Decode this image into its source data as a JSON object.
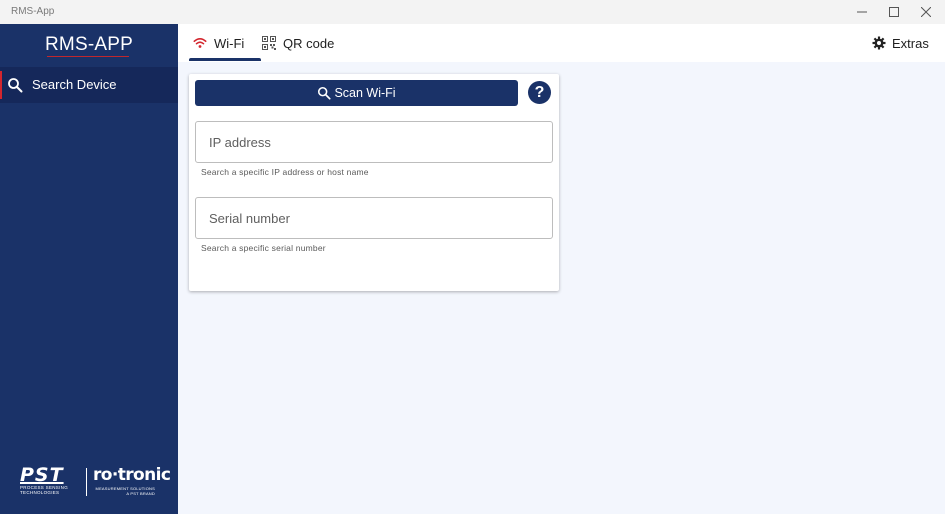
{
  "window": {
    "title": "RMS-App",
    "controls": [
      "minimize-icon",
      "maximize-icon",
      "close-icon"
    ]
  },
  "sidebar": {
    "brand": "RMS-APP",
    "items": [
      {
        "label": "Search Device",
        "icon": "search-icon",
        "active": true
      }
    ],
    "logos": {
      "pst": {
        "name": "PST",
        "line1": "PROCESS SENSING",
        "line2": "TECHNOLOGIES"
      },
      "rotronic": {
        "name": "ro·tronic",
        "line1": "MEASUREMENT SOLUTIONS",
        "line2": "A PST BRAND"
      }
    }
  },
  "tabs": [
    {
      "label": "Wi-Fi",
      "icon": "wifi-icon",
      "active": true
    },
    {
      "label": "QR code",
      "icon": "qr-code-icon",
      "active": false
    }
  ],
  "extras": {
    "label": "Extras",
    "icon": "gear-icon"
  },
  "search_card": {
    "scan_label": "Scan Wi-Fi",
    "help_label": "?",
    "ip_field": {
      "placeholder": "IP address",
      "value": "",
      "hint": "Search a specific IP address or host name"
    },
    "serial_field": {
      "placeholder": "Serial number",
      "value": "",
      "hint": "Search a specific serial number"
    }
  },
  "colors": {
    "primary": "#1a3268",
    "sidebar_active": "#15285a",
    "accent_red": "#d3262e",
    "background": "#f3f6fd"
  }
}
